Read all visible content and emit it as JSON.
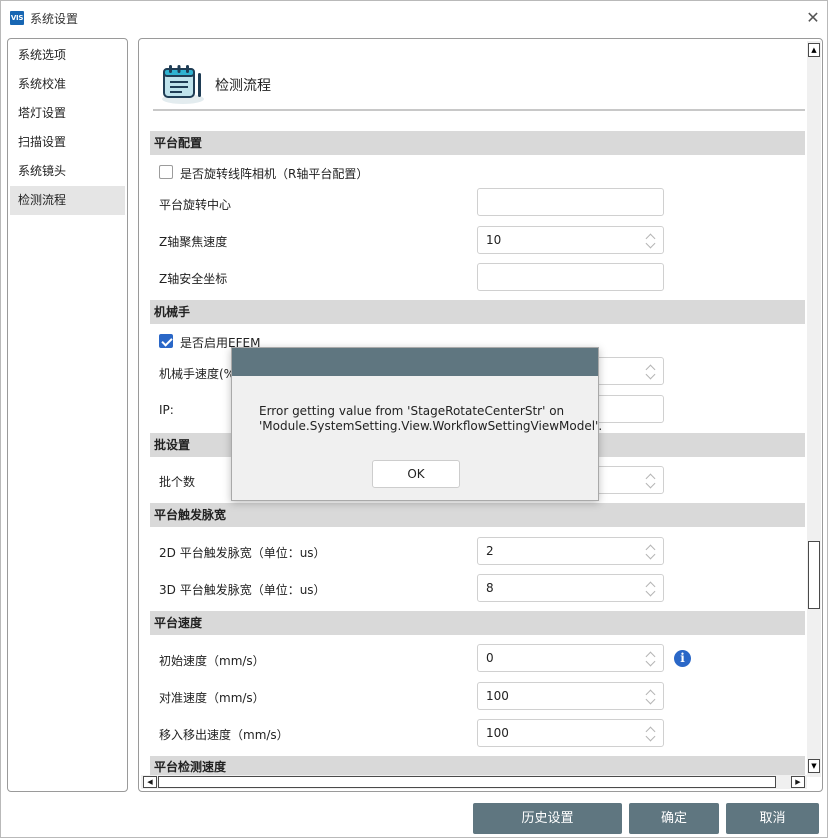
{
  "window": {
    "app_icon": "VIS",
    "title": "系统设置",
    "close_glyph": "✕"
  },
  "nav": {
    "items": [
      {
        "label": "系统选项",
        "active": false
      },
      {
        "label": "系统校准",
        "active": false
      },
      {
        "label": "塔灯设置",
        "active": false
      },
      {
        "label": "扫描设置",
        "active": false
      },
      {
        "label": "系统镜头",
        "active": false
      },
      {
        "label": "检测流程",
        "active": true
      }
    ]
  },
  "header": {
    "icon": "clipboard-icon",
    "title": "检测流程"
  },
  "sections": {
    "platform_config": {
      "title": "平台配置",
      "rotate_camera_checkbox": {
        "label": "是否旋转线阵相机（R轴平台配置）",
        "checked": false
      },
      "rotate_center": {
        "label": "平台旋转中心",
        "value": ""
      },
      "z_focus_speed": {
        "label": "Z轴聚焦速度",
        "value": "10"
      },
      "z_safe_coord": {
        "label": "Z轴安全坐标",
        "value": ""
      }
    },
    "robot": {
      "title": "机械手",
      "efem_checkbox": {
        "label": "是否启用EFEM",
        "checked": true
      },
      "robot_speed": {
        "label": "机械手速度(%)",
        "value": ""
      },
      "ip": {
        "label": "IP:",
        "value": ""
      }
    },
    "batch": {
      "title": "批设置",
      "batch_count": {
        "label": "批个数",
        "value": ""
      }
    },
    "trigger_pulse": {
      "title": "平台触发脉宽",
      "pulse_2d": {
        "label": "2D 平台触发脉宽（单位：us）",
        "value": "2"
      },
      "pulse_3d": {
        "label": "3D 平台触发脉宽（单位：us）",
        "value": "8"
      }
    },
    "platform_speed": {
      "title": "平台速度",
      "initial_speed": {
        "label": "初始速度（mm/s）",
        "value": "0"
      },
      "align_speed": {
        "label": "对准速度（mm/s）",
        "value": "100"
      },
      "move_speed": {
        "label": "移入移出速度（mm/s）",
        "value": "100"
      }
    },
    "platform_detect_speed": {
      "title": "平台检测速度"
    }
  },
  "info_icon": "i",
  "scrollbar": {
    "up": "▲",
    "down": "▼",
    "left": "◀",
    "right": "▶"
  },
  "buttons": {
    "history": "历史设置",
    "confirm": "确定",
    "cancel": "取消"
  },
  "modal": {
    "message": "Error getting value from 'StageRotateCenterStr' on 'Module.SystemSetting.View.WorkflowSettingViewModel'.",
    "ok": "OK"
  },
  "colors": {
    "accent_blue": "#2a67c7",
    "button_slate": "#5f7680",
    "section_gray": "#d9d9d9"
  }
}
